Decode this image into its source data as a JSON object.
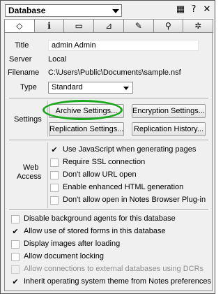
{
  "title_bar": {
    "selector": "Database",
    "icons": [
      "grid-icon",
      "help-icon",
      "close-icon"
    ]
  },
  "tabs": [
    {
      "icon": "info-badge-icon",
      "glyph": "ℹ︎",
      "name": "tab-basics"
    },
    {
      "icon": "info-icon",
      "glyph": "i",
      "name": "tab-info"
    },
    {
      "icon": "printer-icon",
      "glyph": "🖶",
      "name": "tab-print"
    },
    {
      "icon": "design-icon",
      "glyph": "⛻",
      "name": "tab-design"
    },
    {
      "icon": "launch-icon",
      "glyph": "🖌",
      "name": "tab-launch"
    },
    {
      "icon": "search-icon",
      "glyph": "🔍",
      "name": "tab-fulltext"
    },
    {
      "icon": "advanced-icon",
      "glyph": "⚙",
      "name": "tab-advanced"
    }
  ],
  "fields": {
    "title_label": "Title",
    "title_value": "admin Admin",
    "server_label": "Server",
    "server_value": "Local",
    "filename_label": "Filename",
    "filename_value": "C:\\Users\\Public\\Documents\\sample.nsf",
    "type_label": "Type",
    "type_value": "Standard"
  },
  "settings": {
    "label": "Settings",
    "archive": "Archive Settings...",
    "encryption": "Encryption Settings...",
    "replication": "Replication Settings...",
    "history": "Replication History..."
  },
  "web_access": {
    "label_line1": "Web",
    "label_line2": "Access",
    "options": [
      {
        "label": "Use JavaScript when generating pages",
        "checked": true
      },
      {
        "label": "Require SSL connection",
        "checked": false
      },
      {
        "label": "Don't allow URL open",
        "checked": false
      },
      {
        "label": "Enable enhanced HTML generation",
        "checked": false
      },
      {
        "label": "Don't allow open in Notes Browser Plug-in",
        "checked": false
      }
    ]
  },
  "options": [
    {
      "label": "Disable background agents for this database",
      "checked": false
    },
    {
      "label": "Allow use of stored forms in this database",
      "checked": true
    },
    {
      "label": "Display images after loading",
      "checked": false
    },
    {
      "label": "Allow document locking",
      "checked": false
    },
    {
      "label": "Allow connections to external databases using DCRs",
      "checked": false,
      "disabled": true
    },
    {
      "label": "Inherit operating system theme from Notes preferences",
      "checked": true
    }
  ]
}
